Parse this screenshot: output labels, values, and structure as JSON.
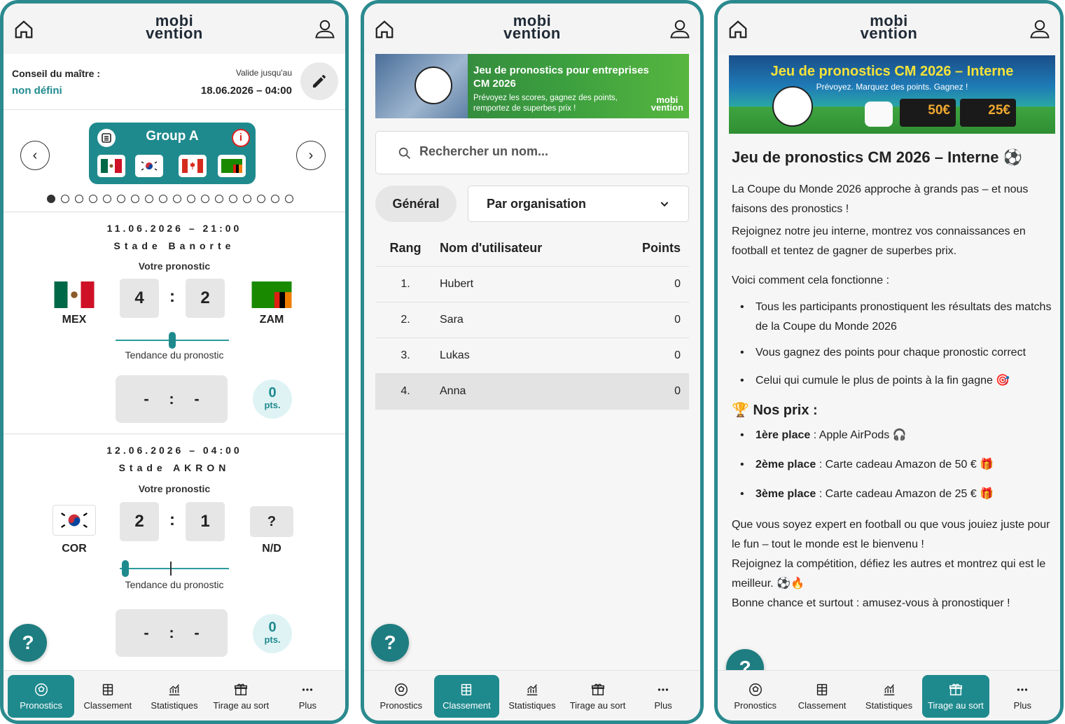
{
  "header": {
    "logo_line1": "mobi",
    "logo_line2": "vention"
  },
  "nav": {
    "items": [
      "Pronostics",
      "Classement",
      "Statistiques",
      "Tirage au sort",
      "Plus"
    ]
  },
  "help_label": "?",
  "screen1": {
    "conseil_title": "Conseil du maître :",
    "conseil_value": "non défini",
    "valid_label": "Valide jusqu'au",
    "valid_date": "18.06.2026 – 04:00",
    "group_title": "Group A",
    "info_icon": "i",
    "page_dots": 18,
    "matches": [
      {
        "date": "11.06.2026 – 21:00",
        "venue": "Stade Banorte",
        "prompt": "Votre pronostic",
        "home": "MEX",
        "away": "ZAM",
        "home_score": "4",
        "away_score": "2",
        "trend_label": "Tendance du pronostic",
        "trend": 0.5,
        "result_home": "-",
        "result_away": "-",
        "points": "0",
        "points_unit": "pts."
      },
      {
        "date": "12.06.2026 – 04:00",
        "venue": "Stade AKRON",
        "prompt": "Votre pronostic",
        "home": "COR",
        "away": "N/D",
        "away_placeholder": "?",
        "home_score": "2",
        "away_score": "1",
        "trend_label": "Tendance du pronostic",
        "trend": 0.05,
        "result_home": "-",
        "result_away": "-",
        "points": "0",
        "points_unit": "pts."
      }
    ]
  },
  "screen2": {
    "banner_title_1": "Jeu de pronostics pour entreprises",
    "banner_title_2": "CM 2026",
    "banner_sub_1": "Prévoyez les scores, gagnez des points,",
    "banner_sub_2": "remportez de superbes prix !",
    "search_placeholder": "Rechercher un nom...",
    "tab_general": "Général",
    "select_value": "Par organisation",
    "columns": [
      "Rang",
      "Nom d'utilisateur",
      "Points"
    ],
    "rows": [
      {
        "rank": "1.",
        "name": "Hubert",
        "points": "0"
      },
      {
        "rank": "2.",
        "name": "Sara",
        "points": "0"
      },
      {
        "rank": "3.",
        "name": "Lukas",
        "points": "0"
      },
      {
        "rank": "4.",
        "name": "Anna",
        "points": "0"
      }
    ]
  },
  "screen3": {
    "banner_title": "Jeu de pronostics CM 2026 – Interne",
    "banner_sub": "Prévoyez. Marquez des points. Gagnez !",
    "card_50": "50€",
    "card_25": "25€",
    "title": "Jeu de pronostics CM 2026 – Interne ⚽",
    "p1": "La Coupe du Monde 2026 approche à grands pas – et nous faisons des pronostics !",
    "p2": "Rejoignez notre jeu interne, montrez vos connaissances en football et tentez de gagner de superbes prix.",
    "p3": "Voici comment cela fonctionne :",
    "rules": [
      "Tous les participants pronostiquent les résultats des matchs de la Coupe du Monde 2026",
      "Vous gagnez des points pour chaque pronostic correct",
      "Celui qui cumule le plus de points à la fin gagne 🎯"
    ],
    "prizes_title": "🏆  Nos prix :",
    "prizes": [
      {
        "place": "1ère place",
        "text": " : Apple AirPods 🎧"
      },
      {
        "place": "2ème place",
        "text": " : Carte cadeau Amazon de 50 € 🎁"
      },
      {
        "place": "3ème place",
        "text": " : Carte cadeau Amazon de 25 € 🎁"
      }
    ],
    "p4": "Que vous soyez expert en football ou que vous jouiez juste pour le fun – tout le monde est le bienvenu !",
    "p5": "Rejoignez la compétition, défiez les autres et montrez qui est le meilleur. ⚽🔥",
    "p6": "Bonne chance et surtout : amusez-vous à pronostiquer !"
  },
  "colors": {
    "accent": "#1f8a8e",
    "link": "#1f8a8e",
    "pts_bg": "#dff3f4"
  }
}
